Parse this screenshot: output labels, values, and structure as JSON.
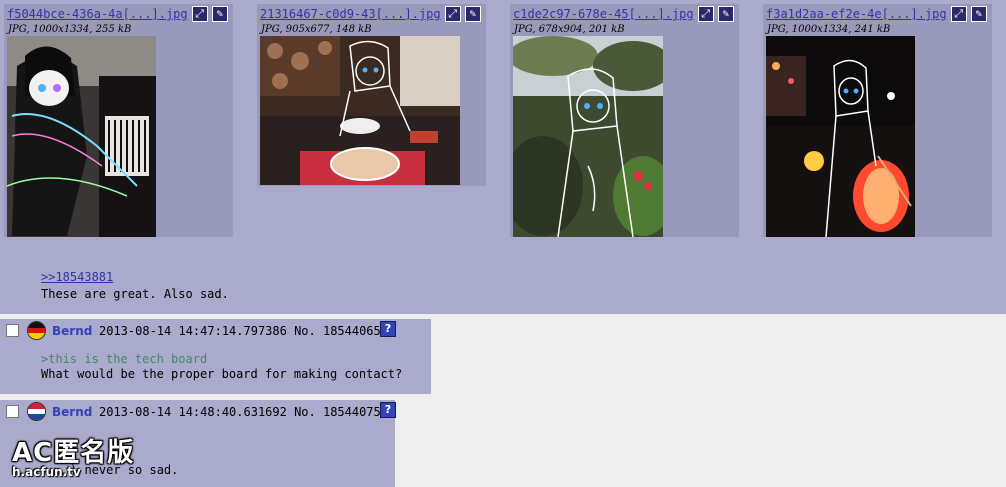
{
  "files": [
    {
      "name": "f5044bce-436a-4a[...].jpg",
      "meta": "JPG, 1000x1334, 255 kB",
      "image": "anime-girl-at-piano-photo"
    },
    {
      "name": "21316467-c0d9-43[...].jpg",
      "meta": "JPG, 905x677, 148 kB",
      "image": "anime-girl-at-restaurant-table-photo"
    },
    {
      "name": "c1de2c97-678e-45[...].jpg",
      "meta": "JPG, 678x904, 201 kB",
      "image": "anime-girl-in-forest-photo"
    },
    {
      "name": "f3a1d2aa-ef2e-4e[...].jpg",
      "meta": "JPG, 1000x1334, 241 kB",
      "image": "anime-girl-with-lantern-night-street-photo"
    }
  ],
  "post_top": {
    "quote_link": ">>18543881",
    "message": "These are great. Also sad."
  },
  "replies": [
    {
      "name": "Bernd",
      "datetime": "2013-08-14 14:47:14.797386 No. 18544065",
      "greentext": ">this is the tech board",
      "message": "What would be the proper board for making contact?",
      "flag": "germany-flag-icon"
    },
    {
      "name": "Bernd",
      "datetime": "2013-08-14 14:48:40.631692 No. 18544075",
      "message": ") never so sad.",
      "flag": "netherlands-flag-icon"
    }
  ],
  "watermark": {
    "title": "AC匿名版",
    "domain": "h.acfun.tv"
  },
  "colors": {
    "post_bg": "#AAAACC",
    "page_bg": "#EEEEEE",
    "name": "#3344BB",
    "greentext": "#448866"
  }
}
